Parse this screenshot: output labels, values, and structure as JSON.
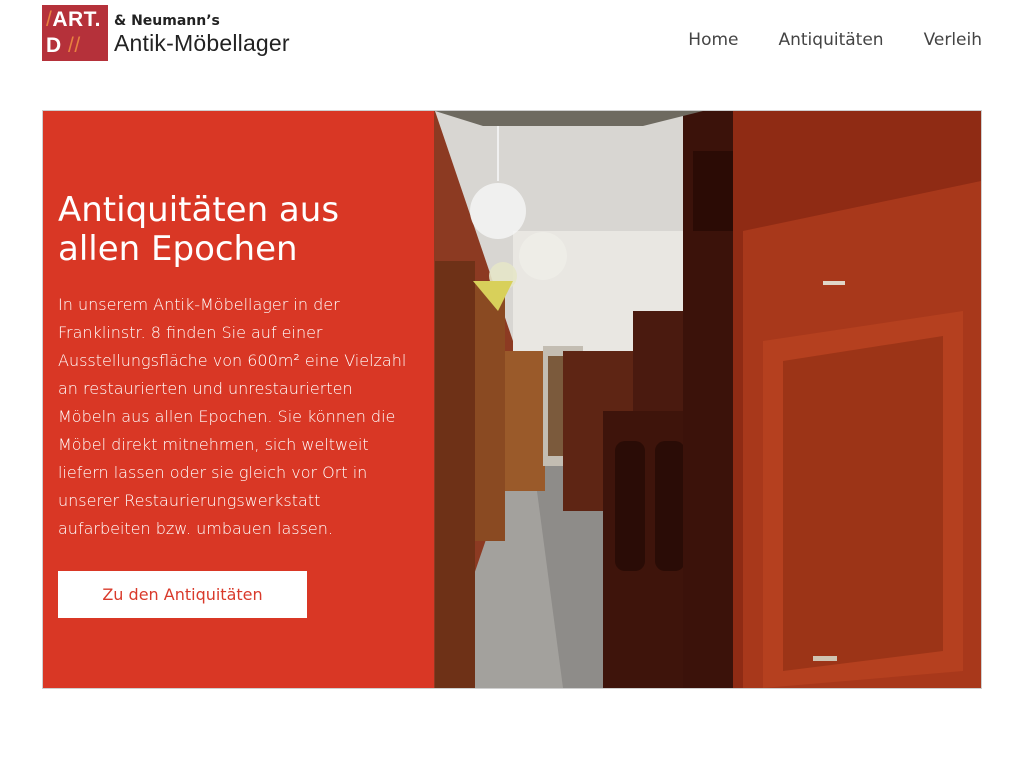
{
  "header": {
    "logo": {
      "mark_line1": "ART.",
      "mark_line2": "D",
      "slash1": "/",
      "slash2": "//",
      "top_text": "& Neumann’s",
      "bottom_text": "Antik-Möbellager"
    },
    "nav": [
      {
        "label": "Home"
      },
      {
        "label": "Antiquitäten"
      },
      {
        "label": "Verleih"
      }
    ]
  },
  "hero": {
    "title": "Antiquitäten aus allen Epochen",
    "text": "In unserem Antik-Möbellager in der Franklinstr. 8 finden Sie auf einer Ausstellungsfläche von 600m² eine Vielzahl an restaurierten und unrestaurierten Möbeln aus allen Epochen. Sie können die Möbel direkt mitnehmen, sich weltweit liefern lassen oder sie gleich vor Ort in unserer Restaurierungswerkstatt aufarbeiten bzw. umbauen lassen.",
    "button_label": "Zu den Antiquitäten",
    "photo_icon": "furniture-warehouse-photo"
  },
  "colors": {
    "brand_red": "#b5313a",
    "overlay_red": "#e53726",
    "button_text": "#d93a2b",
    "accent_orange": "#e8813f"
  }
}
